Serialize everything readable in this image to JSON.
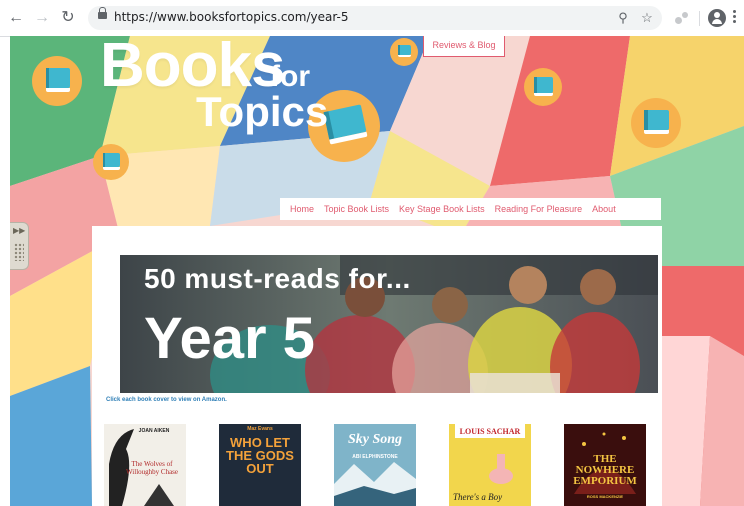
{
  "browser": {
    "url": "https://www.booksfortopics.com/year-5",
    "icons": [
      "back-icon",
      "forward-icon",
      "reload-icon",
      "lock-icon",
      "zoom-icon",
      "star-icon",
      "extension-icon",
      "profile-icon",
      "menu-icon"
    ]
  },
  "logo": {
    "line1": "Books",
    "for": "for",
    "line2": "Topics"
  },
  "header": {
    "reviews_label": "Reviews & Blog"
  },
  "nav": {
    "items": [
      {
        "label": "Home"
      },
      {
        "label": "Topic Book Lists"
      },
      {
        "label": "Key Stage Book Lists"
      },
      {
        "label": "Reading For Pleasure"
      },
      {
        "label": "About"
      }
    ]
  },
  "banner": {
    "line1": "50 must-reads for...",
    "line2": "Year 5"
  },
  "note": "Click each book cover to view on Amazon.",
  "covers": [
    {
      "title": "The Wolves of Willoughby Chase",
      "author": "JOAN AIKEN",
      "bg": "#f2efe8"
    },
    {
      "title": "WHO LET THE GODS OUT",
      "author": "Maz Evans",
      "bg": "#1f2b3a"
    },
    {
      "title": "Sky Song",
      "author": "ABI ELPHINSTONE",
      "bg": "#3b6f8c"
    },
    {
      "title": "There's a Boy",
      "author": "LOUIS SACHAR",
      "bg": "#f2d64c"
    },
    {
      "title": "THE NOWHERE EMPORIUM",
      "author": "ROSS MACKENZIE",
      "bg": "#4a1412"
    }
  ],
  "colors": {
    "accent": "#e05b6f",
    "book": "#3fb7cf",
    "circle": "#f7b24d"
  }
}
